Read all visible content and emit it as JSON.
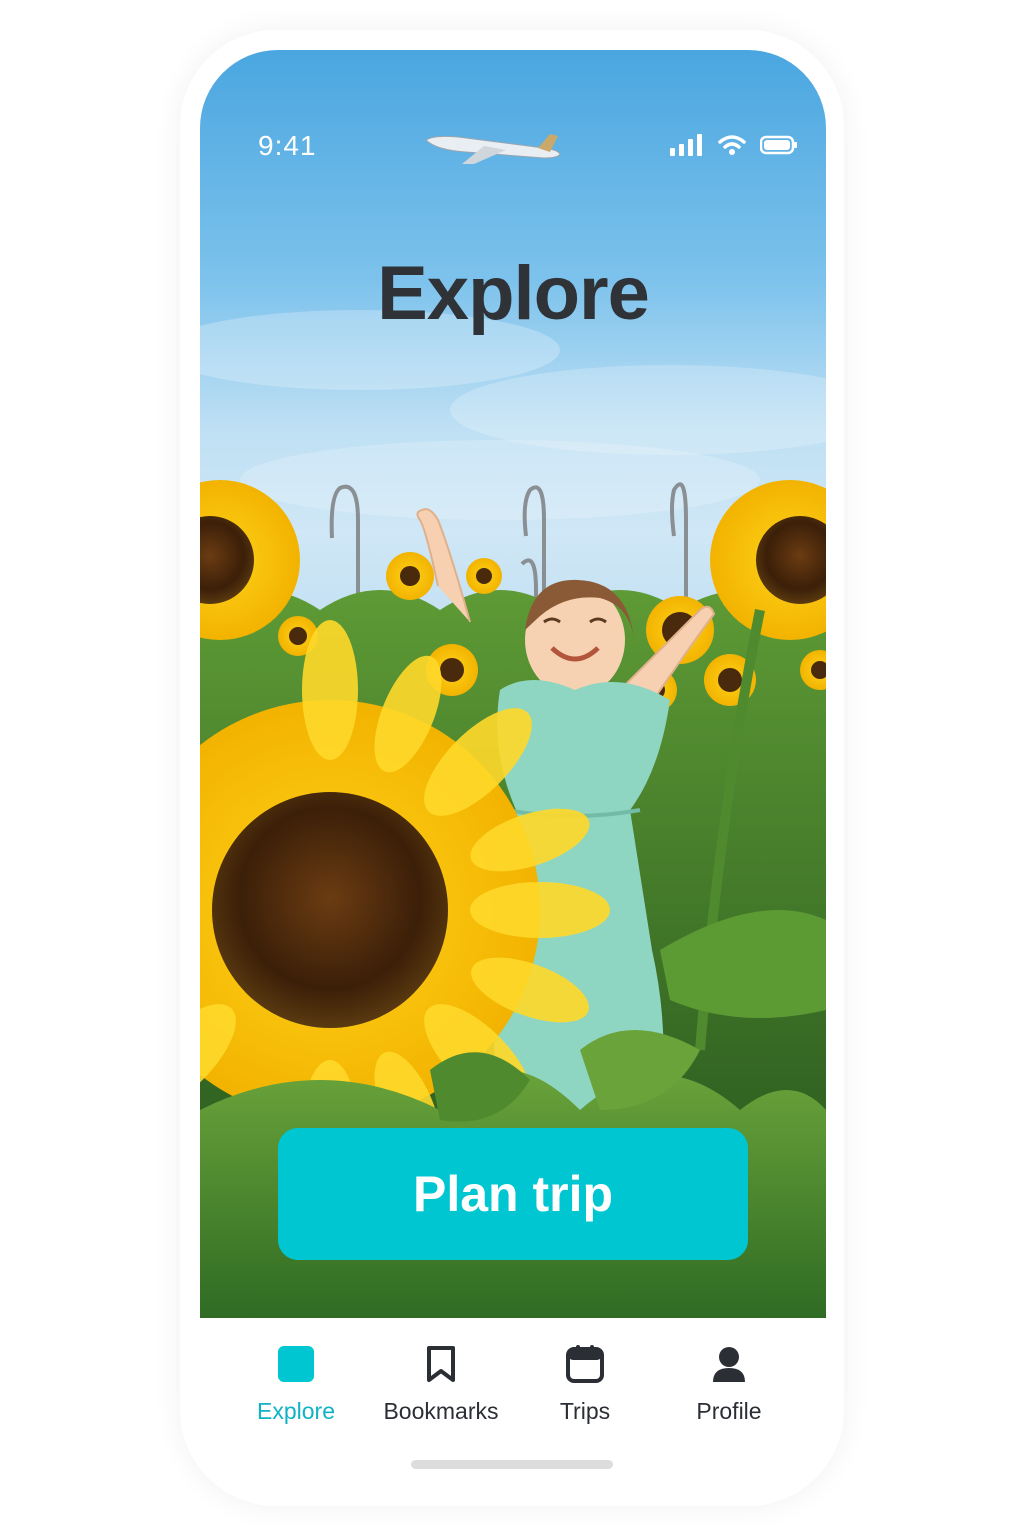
{
  "status_bar": {
    "time": "9:41",
    "icons": [
      "signal-icon",
      "wifi-icon",
      "battery-icon"
    ]
  },
  "hero": {
    "title": "Explore",
    "image": "sunflower-field-child-photo"
  },
  "cta": {
    "label": "Plan trip",
    "color": "#00c6d2"
  },
  "tabs": [
    {
      "label": "Explore",
      "icon": "explore-icon",
      "active": true
    },
    {
      "label": "Bookmarks",
      "icon": "bookmark-icon",
      "active": false
    },
    {
      "label": "Trips",
      "icon": "calendar-icon",
      "active": false
    },
    {
      "label": "Profile",
      "icon": "profile-icon",
      "active": false
    }
  ],
  "colors": {
    "accent": "#00c6d2",
    "active_tab": "#10b3c6",
    "title_text": "#2f3338"
  }
}
